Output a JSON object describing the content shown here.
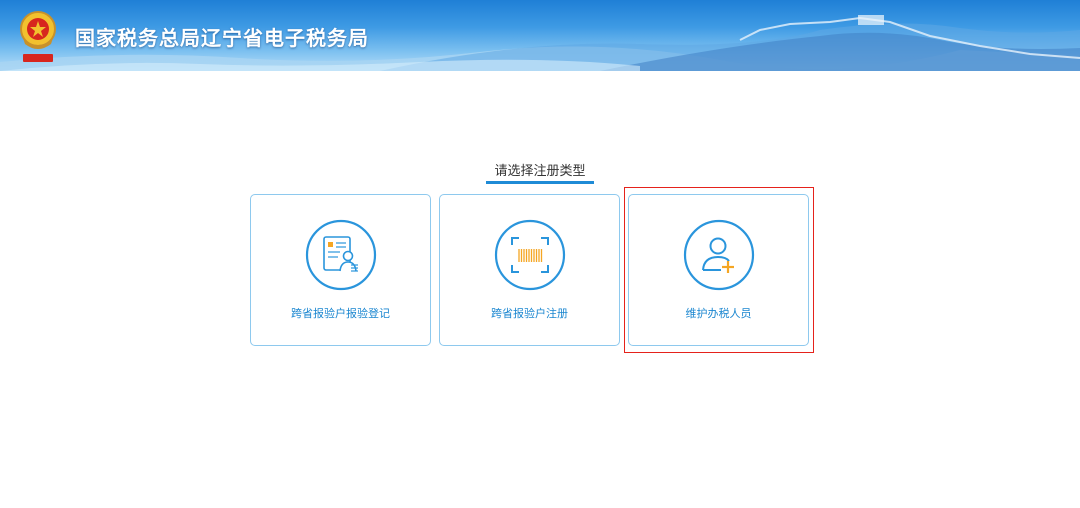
{
  "header": {
    "site_title": "国家税务总局辽宁省电子税务局",
    "emblem_alt": "中国税务"
  },
  "main": {
    "section_title": "请选择注册类型",
    "cards": [
      {
        "label": "跨省报验户报验登记",
        "icon": "id-card-person-icon"
      },
      {
        "label": "跨省报验户注册",
        "icon": "barcode-scan-icon"
      },
      {
        "label": "维护办税人员",
        "icon": "add-user-icon",
        "highlighted": true
      }
    ]
  },
  "colors": {
    "accent": "#1f8bd6",
    "card_border": "#8ec9ee",
    "icon_orange": "#f5a623",
    "highlight_red": "#e5221b"
  }
}
